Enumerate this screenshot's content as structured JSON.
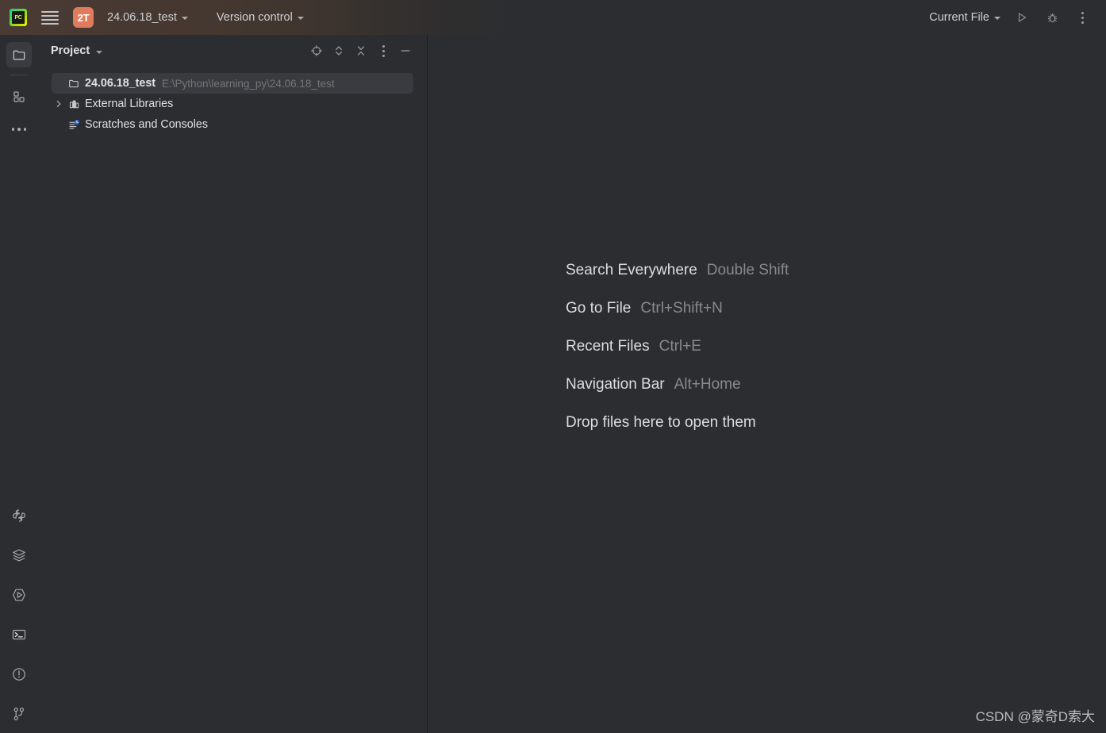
{
  "titlebar": {
    "logo_icon": "pycharm-logo-icon",
    "logo_text": "PC",
    "menu_icon": "hamburger-menu-icon",
    "project_badge": "2T",
    "project_name": "24.06.18_test",
    "vcs_label": "Version control",
    "run_config_label": "Current File",
    "run_icon": "run-play-icon",
    "debug_icon": "debug-bug-icon",
    "more_icon": "more-vertical-dots-icon"
  },
  "stripe": {
    "top": [
      {
        "name": "project-tool-icon",
        "tooltip": "Project",
        "active": true
      },
      {
        "name": "structure-tool-icon",
        "tooltip": "Structure",
        "active": false
      },
      {
        "name": "more-tool-windows-icon",
        "tooltip": "More Tool Windows",
        "active": false
      }
    ],
    "bottom": [
      {
        "name": "python-console-icon",
        "tooltip": "Python Console"
      },
      {
        "name": "database-layers-icon",
        "tooltip": "Database"
      },
      {
        "name": "run-tool-icon",
        "tooltip": "Run"
      },
      {
        "name": "terminal-icon",
        "tooltip": "Terminal"
      },
      {
        "name": "problems-icon",
        "tooltip": "Problems"
      },
      {
        "name": "version-control-branch-icon",
        "tooltip": "Version Control"
      }
    ]
  },
  "panel": {
    "title": "Project",
    "tools": [
      {
        "name": "select-opened-file-icon",
        "tooltip": "Select Opened File"
      },
      {
        "name": "expand-all-icon",
        "tooltip": "Expand All"
      },
      {
        "name": "collapse-all-icon",
        "tooltip": "Collapse All"
      },
      {
        "name": "panel-options-icon",
        "tooltip": "Options"
      },
      {
        "name": "hide-panel-icon",
        "tooltip": "Hide"
      }
    ],
    "tree": [
      {
        "label": "24.06.18_test",
        "path": "E:\\Python\\learning_py\\24.06.18_test",
        "icon": "folder-icon",
        "selected": true,
        "bold": true,
        "arrow": ""
      },
      {
        "label": "External Libraries",
        "path": "",
        "icon": "library-icon",
        "selected": false,
        "bold": false,
        "arrow": "collapsed"
      },
      {
        "label": "Scratches and Consoles",
        "path": "",
        "icon": "scratches-icon",
        "selected": false,
        "bold": false,
        "arrow": ""
      }
    ]
  },
  "editor": {
    "hints": [
      {
        "name": "Search Everywhere",
        "key": "Double Shift"
      },
      {
        "name": "Go to File",
        "key": "Ctrl+Shift+N"
      },
      {
        "name": "Recent Files",
        "key": "Ctrl+E"
      },
      {
        "name": "Navigation Bar",
        "key": "Alt+Home"
      },
      {
        "name": "Drop files here to open them",
        "key": ""
      }
    ],
    "watermark": "CSDN @蒙奇D索大"
  },
  "colors": {
    "background": "#2B2D30",
    "panel_border": "#1E1F22",
    "selection": "#393B40",
    "text_primary": "#DFE1E5",
    "text_secondary": "#868A91",
    "badge_accent": "#E07B5E",
    "scratch_badge": "#3574F0"
  }
}
